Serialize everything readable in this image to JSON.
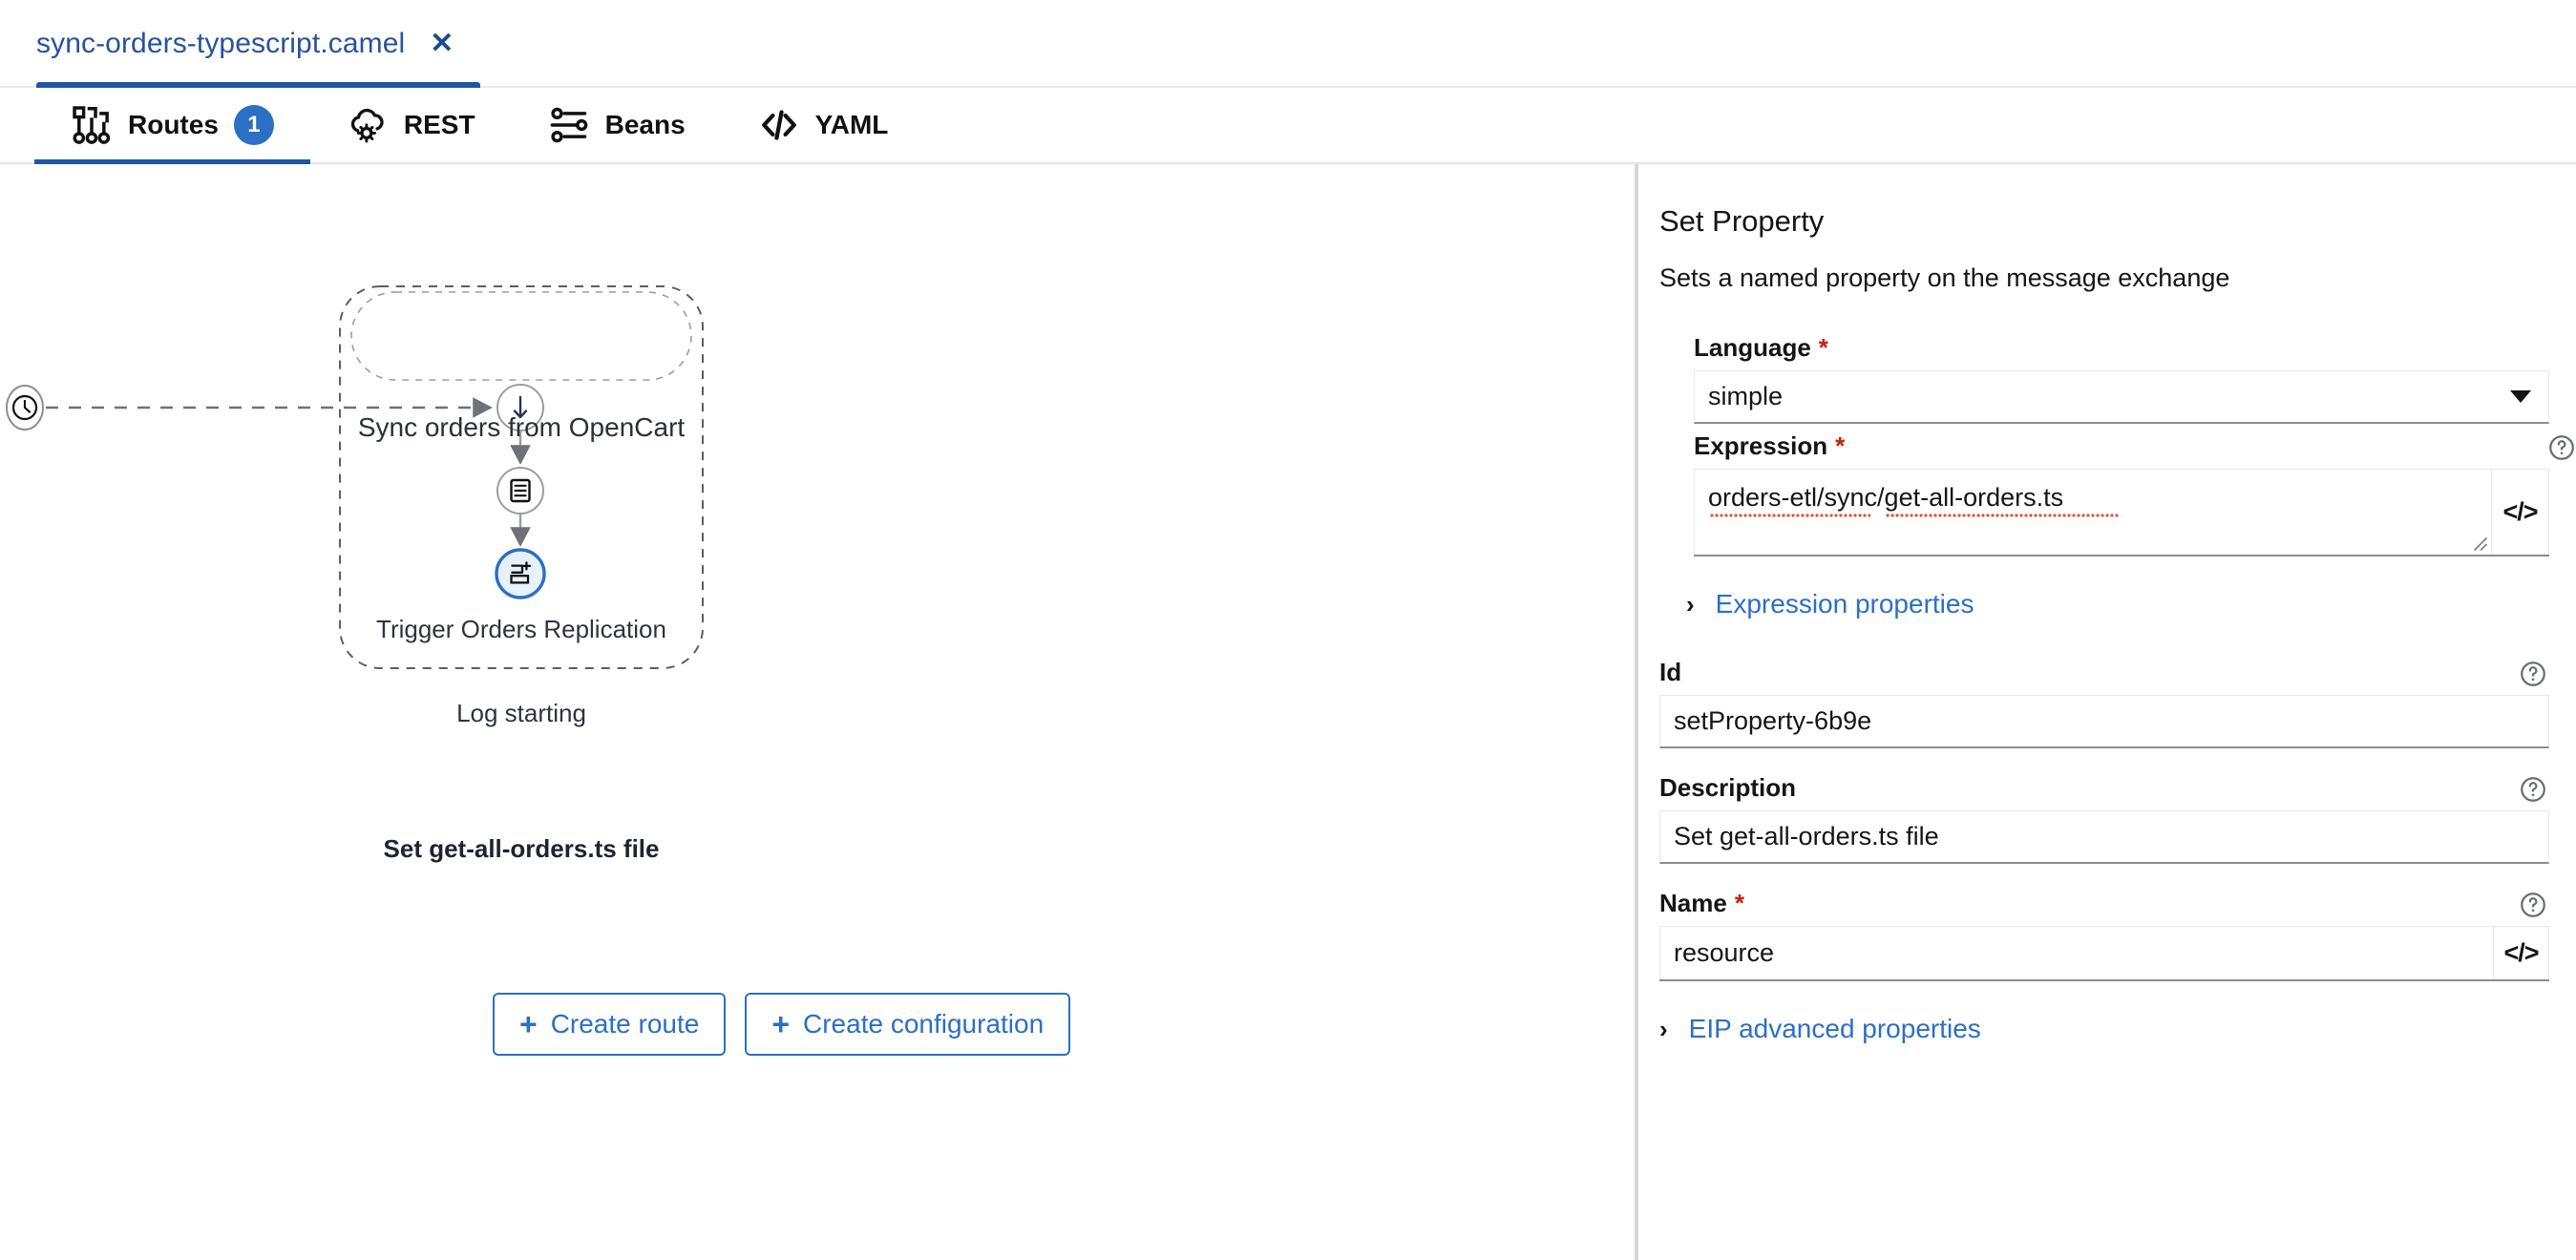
{
  "file_tab": {
    "label": "sync-orders-typescript.camel",
    "close_label": "✕"
  },
  "tabs": [
    {
      "label": "Routes",
      "icon": "routes-topology-icon",
      "badge": "1",
      "active": true
    },
    {
      "label": "REST",
      "icon": "rest-cloud-gear-icon",
      "active": false
    },
    {
      "label": "Beans",
      "icon": "beans-sliders-icon",
      "active": false
    },
    {
      "label": "YAML",
      "icon": "yaml-code-icon",
      "active": false
    }
  ],
  "canvas": {
    "route_title": "Sync orders from OpenCart",
    "source_icon": "clock-timer-icon",
    "nodes": [
      {
        "label": "Trigger Orders Replication",
        "icon": "arrow-down-icon",
        "selected": false
      },
      {
        "label": "Log starting",
        "icon": "log-document-icon",
        "selected": false
      },
      {
        "label": "Set get-all-orders.ts file",
        "icon": "set-property-plus-icon",
        "selected": true
      }
    ],
    "buttons": [
      {
        "label": "Create route",
        "plus": "+"
      },
      {
        "label": "Create configuration",
        "plus": "+"
      }
    ]
  },
  "panel": {
    "title": "Set Property",
    "subtitle": "Sets a named property on the message exchange",
    "language": {
      "label": "Language",
      "required": "*",
      "value": "simple"
    },
    "expression": {
      "label": "Expression",
      "required": "*",
      "value": "orders-etl/sync/get-all-orders.ts",
      "code_glyph": "</>",
      "help_icon": "help-circle-icon"
    },
    "expression_properties": {
      "label": "Expression properties",
      "chevron": "›"
    },
    "id": {
      "label": "Id",
      "value": "setProperty-6b9e",
      "help_icon": "help-circle-icon"
    },
    "description": {
      "label": "Description",
      "value": "Set get-all-orders.ts file",
      "help_icon": "help-circle-icon"
    },
    "name": {
      "label": "Name",
      "required": "*",
      "value": "resource",
      "code_glyph": "</>",
      "help_icon": "help-circle-icon"
    },
    "eip_advanced": {
      "label": "EIP advanced properties",
      "chevron": "›"
    }
  },
  "colors": {
    "accent_blue": "#2c6fc4",
    "tab_underline": "#1f55a3",
    "required_red": "#c9190b",
    "selected_node_ring": "#2c6fc4",
    "selected_node_fill": "#e7f1fb"
  }
}
